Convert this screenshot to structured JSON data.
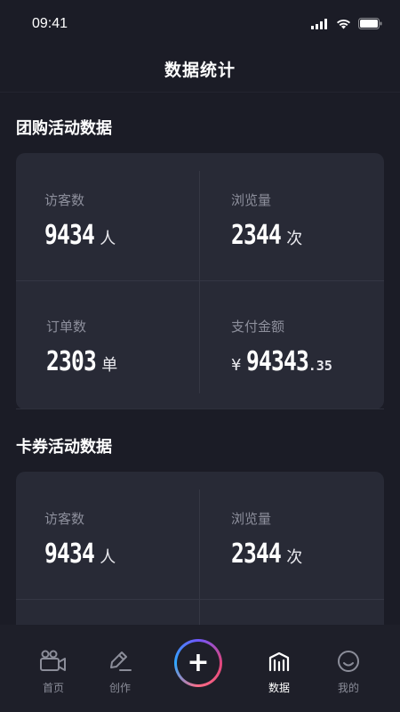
{
  "status_bar": {
    "time": "09:41"
  },
  "nav": {
    "title": "数据统计"
  },
  "group_buy": {
    "title": "团购活动数据",
    "visitors": {
      "label": "访客数",
      "value": "9434",
      "unit": "人"
    },
    "views": {
      "label": "浏览量",
      "value": "2344",
      "unit": "次"
    },
    "orders": {
      "label": "订单数",
      "value": "2303",
      "unit": "单"
    },
    "payment": {
      "label": "支付金额",
      "currency": "¥",
      "value": "94343",
      "decimals": ".35"
    }
  },
  "coupon": {
    "title": "卡券活动数据",
    "visitors": {
      "label": "访客数",
      "value": "9434",
      "unit": "人"
    },
    "views": {
      "label": "浏览量",
      "value": "2344",
      "unit": "次"
    }
  },
  "tabbar": {
    "home": "首页",
    "create": "创作",
    "create_button": "+",
    "data": "数据",
    "mine": "我的"
  },
  "colors": {
    "background": "#1b1c26",
    "card": "#282a36",
    "accent_gradient": [
      "#6f57ff",
      "#e0457b",
      "#2fa8ff"
    ]
  },
  "icons": [
    "signal-icon",
    "wifi-icon",
    "battery-icon",
    "video-camera-icon",
    "pencil-icon",
    "plus-icon",
    "chart-icon",
    "smiley-icon"
  ]
}
